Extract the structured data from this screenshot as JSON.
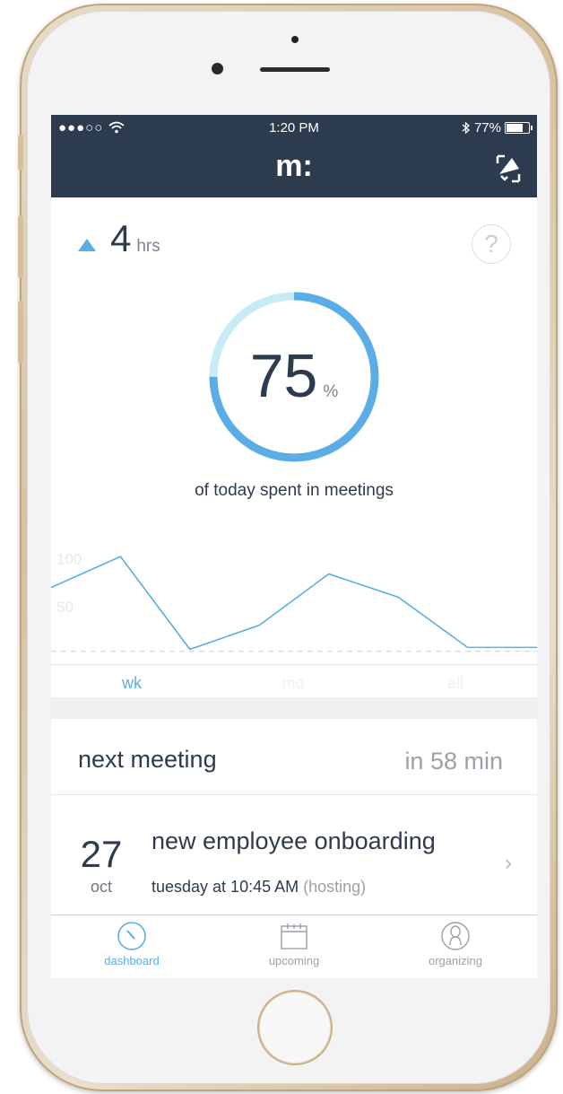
{
  "status_bar": {
    "carrier": "●●●○○",
    "wifi_icon": "wifi-icon",
    "time": "1:20 PM",
    "bluetooth_icon": "bluetooth-icon",
    "battery": "77%",
    "battery_level": 0.77
  },
  "navbar": {
    "logo": "m:",
    "action_icon": "megaphone-icon"
  },
  "summary": {
    "hours_value": "4",
    "hours_unit": "hrs",
    "trend": "up",
    "help": "?"
  },
  "meeting_percent": {
    "value": "75",
    "unit": "%",
    "fraction": 0.75,
    "caption": "of today spent in meetings"
  },
  "chart_data": {
    "type": "line",
    "y_ticks": [
      "100",
      "50"
    ],
    "values": [
      70,
      102,
      6,
      31,
      84,
      60,
      8,
      8
    ],
    "reference": 4,
    "ylim": [
      0,
      130
    ],
    "grid": false,
    "color": "#5aaee5"
  },
  "period_tabs": [
    {
      "label": "wk",
      "active": true
    },
    {
      "label": "mo",
      "active": false
    },
    {
      "label": "all",
      "active": false
    }
  ],
  "next_meeting": {
    "label": "next meeting",
    "time_until": "in 58 min"
  },
  "meeting": {
    "day": "27",
    "month": "oct",
    "title": "new employee onboarding",
    "when": "tuesday at 10:45 AM",
    "role": "(hosting)"
  },
  "tab_bar": [
    {
      "label": "dashboard",
      "icon": "dashboard-icon",
      "active": true
    },
    {
      "label": "upcoming",
      "icon": "calendar-icon",
      "active": false
    },
    {
      "label": "organizing",
      "icon": "person-icon",
      "active": false
    }
  ],
  "colors": {
    "navy": "#2d3b4e",
    "accent": "#5aaee5",
    "ring_track": "#c9ebf6",
    "muted": "#9aa1a9"
  }
}
